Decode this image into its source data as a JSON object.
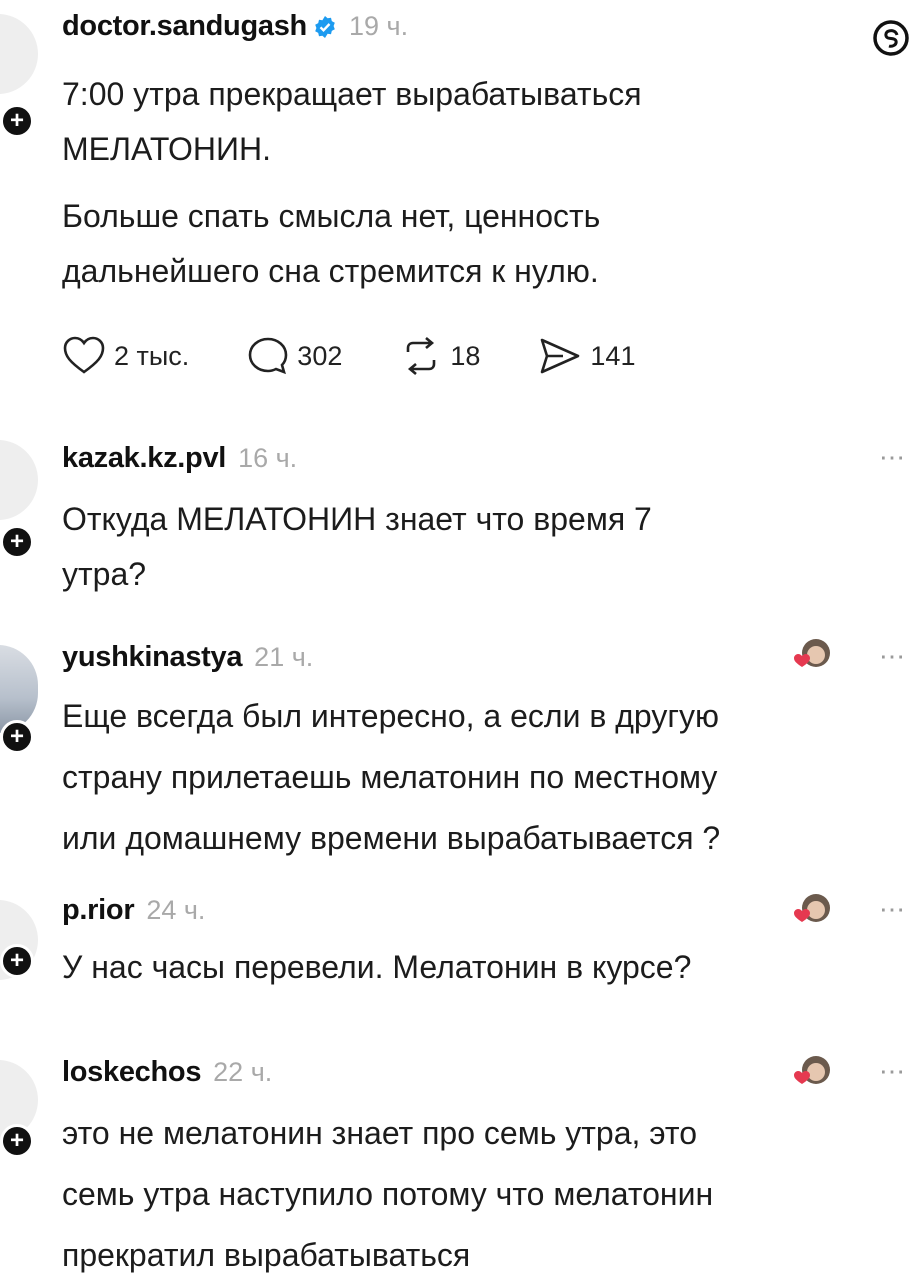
{
  "post": {
    "username": "doctor.sandugash",
    "time": "19 ч.",
    "text_line1": "7:00 утра прекращает вырабатываться",
    "text_line2": "МЕЛАТОНИН.",
    "text_line3": "Больше спать смысла нет, ценность",
    "text_line4": "дальнейшего сна стремится к нулю.",
    "likes": "2 тыс.",
    "comments": "302",
    "reposts": "18",
    "shares": "141"
  },
  "replies": [
    {
      "username": "kazak.kz.pvl",
      "time": "16 ч.",
      "lines": [
        "Откуда МЕЛАТОНИН  знает что время 7",
        "утра?"
      ]
    },
    {
      "username": "yushkinastya",
      "time": "21 ч.",
      "lines": [
        "Еще всегда был интересно, а если в другую",
        "страну прилетаешь мелатонин по местному",
        "или домашнему времени вырабатывается ?"
      ]
    },
    {
      "username": "p.rior",
      "time": "24 ч.",
      "lines": [
        "У нас часы перевели. Мелатонин в курсе?"
      ]
    },
    {
      "username": "loskechos",
      "time": "22 ч.",
      "lines": [
        "это не мелатонин знает про семь утра, это",
        "семь утра наступило потому что мелатонин",
        "прекратил вырабатываться"
      ]
    }
  ],
  "icons": {
    "more": "⋯",
    "threads_logo": "threads-logo-icon"
  }
}
